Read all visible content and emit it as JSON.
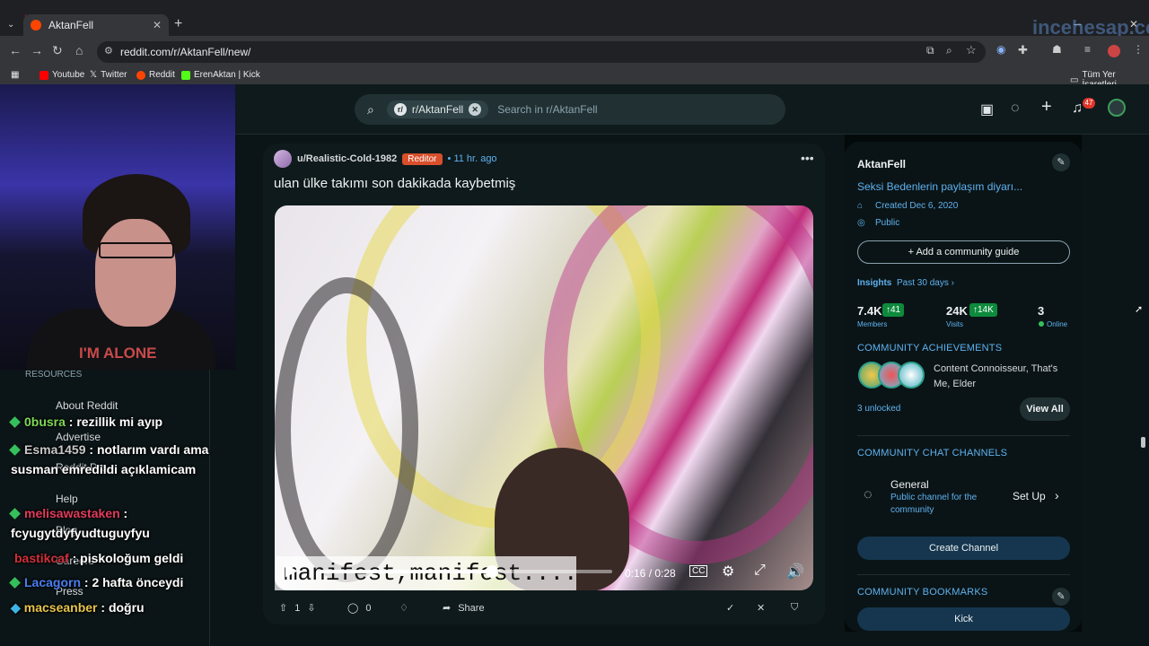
{
  "browser": {
    "tab_title": "AktanFell",
    "url": "reddit.com/r/AktanFell/new/",
    "bookmarks": [
      "Youtube",
      "Twitter",
      "Reddit",
      "ErenAktan | Kick"
    ],
    "all_bookmarks": "Tüm Yer İşaretleri"
  },
  "header": {
    "search_chip": "r/AktanFell",
    "search_placeholder": "Search in r/AktanFell",
    "notification_count": "47"
  },
  "post": {
    "author": "u/Realistic-Cold-1982",
    "flair": "Reditor",
    "time": "11 hr. ago",
    "title": "ulan ülke takımı son dakikada kaybetmiş",
    "subtitle_overlay": "manifest,manifest....",
    "video_time": "0:16 / 0:28",
    "video_progress": 0.59,
    "votes": "1",
    "comments": "0",
    "share": "Share"
  },
  "sidebar": {
    "name": "AktanFell",
    "description": "Seksi Bedenlerin paylaşım diyarı...",
    "created": "Created Dec 6, 2020",
    "visibility": "Public",
    "add_guide": "Add a community guide",
    "insights": "Insights",
    "insights_period": "Past 30 days ›",
    "members": "7.4K",
    "members_delta": "↑41",
    "members_label": "Members",
    "visits": "24K",
    "visits_delta": "↑14K",
    "visits_label": "Visits",
    "online": "3",
    "online_label": "Online",
    "achievements_head": "COMMUNITY ACHIEVEMENTS",
    "achievements": "Content Connoisseur, That's Me, Elder",
    "unlocked": "3 unlocked",
    "view_all": "View All",
    "chat_head": "COMMUNITY CHAT CHANNELS",
    "channel_name": "General",
    "channel_desc": "Public channel for the community",
    "set_up": "Set Up",
    "create_channel": "Create Channel",
    "bookmarks_head": "COMMUNITY BOOKMARKS",
    "bookmark_kick": "Kick"
  },
  "left_menu": {
    "resources": "RESOURCES",
    "items": [
      "About Reddit",
      "Advertise",
      "Reddit Pro",
      "Help",
      "Blog",
      "Careers",
      "Press"
    ]
  },
  "chat": [
    {
      "user": "0busra",
      "msg": " : rezillik mi ayıp",
      "color": "#7ed957"
    },
    {
      "user": "Esma1459",
      "msg": " : notlarım vardı ama susman emredildi açıklamicam",
      "color": "#c7c7c7"
    },
    {
      "user": "melisawastaken",
      "msg": " :",
      "color": "#e23b5c"
    },
    {
      "user": "",
      "msg": "fcyugytdyfyudtuguyfyu",
      "color": "#fff"
    },
    {
      "user": "bastikcaf",
      "msg": " : piskoloğum geldi",
      "color": "#d22f3a"
    },
    {
      "user": "Lacagorn",
      "msg": " : 2 hafta önceydi",
      "color": "#4a7ef0"
    },
    {
      "user": "macseanber",
      "msg": " : doğru",
      "color": "#e6c44a"
    }
  ],
  "overlay": {
    "shirt_text": "I'M ALONE",
    "watermark": "incehesap.com"
  }
}
